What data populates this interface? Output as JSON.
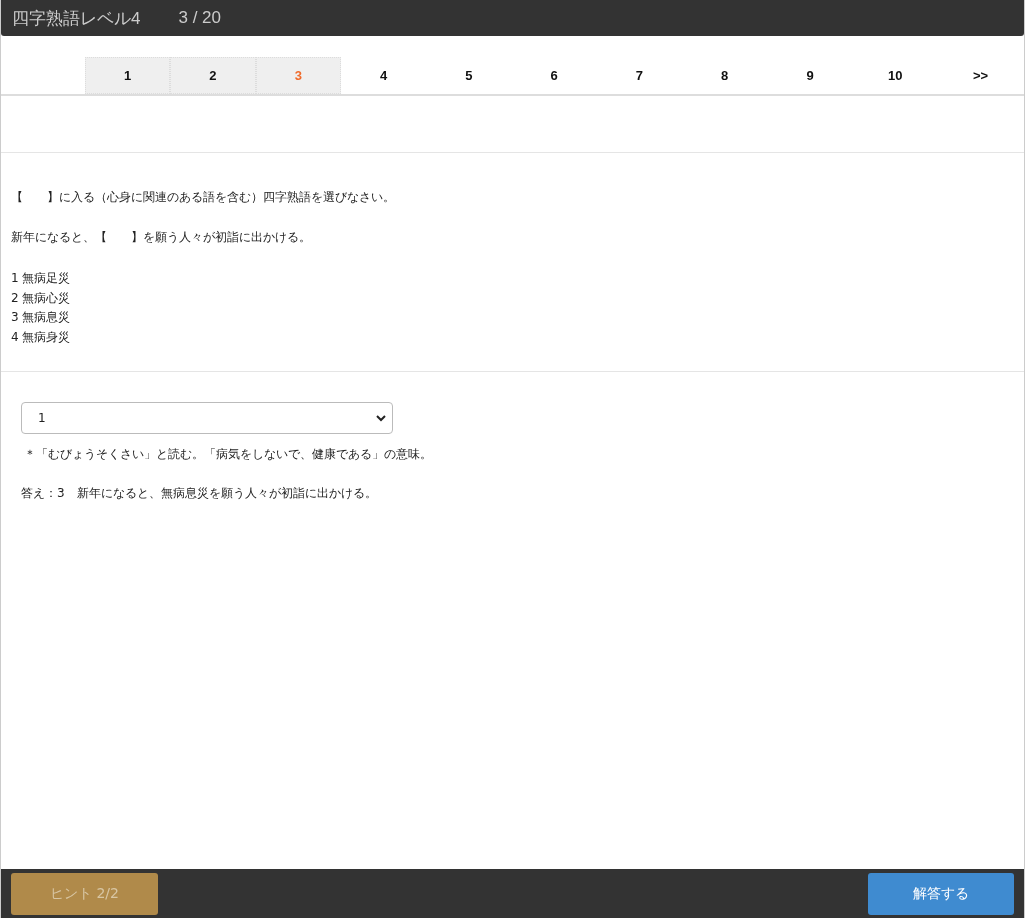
{
  "header": {
    "title": "四字熟語レベル4",
    "progress": "3 / 20"
  },
  "pager": [
    {
      "label": "1",
      "selected": false,
      "visited": true
    },
    {
      "label": "2",
      "selected": false,
      "visited": true
    },
    {
      "label": "3",
      "selected": true,
      "visited": true
    },
    {
      "label": "4",
      "selected": false,
      "visited": false
    },
    {
      "label": "5",
      "selected": false,
      "visited": false
    },
    {
      "label": "6",
      "selected": false,
      "visited": false
    },
    {
      "label": "7",
      "selected": false,
      "visited": false
    },
    {
      "label": "8",
      "selected": false,
      "visited": false
    },
    {
      "label": "9",
      "selected": false,
      "visited": false
    },
    {
      "label": "10",
      "selected": false,
      "visited": false
    },
    {
      "label": ">>",
      "selected": false,
      "visited": false
    }
  ],
  "question": {
    "instruction": "【　　】に入る（心身に関連のある語を含む）四字熟語を選びなさい。",
    "sentence": "新年になると、【　　】を願う人々が初詣に出かける。",
    "choices": [
      "1 無病足災",
      "2 無病心災",
      "3 無病息災",
      "4 無病身災"
    ]
  },
  "answer": {
    "select_value": "1",
    "note": "＊「むびょうそくさい」と読む。「病気をしないで、健康である」の意味。",
    "result": "答え：3　新年になると、無病息災を願う人々が初詣に出かける。"
  },
  "footer": {
    "hint_button": {
      "label": "ヒント 2/2",
      "disabled": true
    },
    "submit_button": {
      "label": "解答する",
      "disabled": false
    }
  }
}
